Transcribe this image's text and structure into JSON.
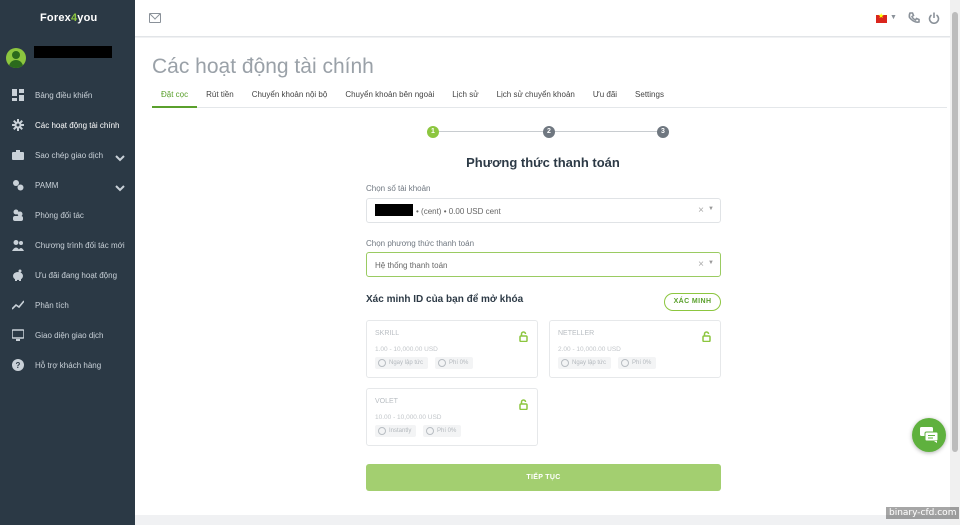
{
  "brand": {
    "logo_pre": "Forex",
    "logo_four": "4",
    "logo_post": "you"
  },
  "sidebar": {
    "items": [
      {
        "label": "Bảng điều khiển",
        "icon": "dashboard-icon"
      },
      {
        "label": "Các hoạt động tài chính",
        "icon": "gear-icon",
        "active": true
      },
      {
        "label": "Sao chép giao dịch",
        "icon": "briefcase-icon",
        "expandable": true
      },
      {
        "label": "PAMM",
        "icon": "pamm-icon",
        "expandable": true
      },
      {
        "label": "Phòng đối tác",
        "icon": "partner-icon"
      },
      {
        "label": "Chương trình đối tác mới",
        "icon": "users-icon"
      },
      {
        "label": "Ưu đãi đang hoạt động",
        "icon": "piggy-icon"
      },
      {
        "label": "Phân tích",
        "icon": "chart-line-icon"
      },
      {
        "label": "Giao diện giao dịch",
        "icon": "terminal-icon"
      },
      {
        "label": "Hỗ trợ khách hàng",
        "icon": "help-icon"
      }
    ]
  },
  "header": {
    "page_title": "Các hoạt động tài chính",
    "tabs": [
      {
        "label": "Đặt cọc",
        "active": true
      },
      {
        "label": "Rút tiền"
      },
      {
        "label": "Chuyển khoản nội bộ"
      },
      {
        "label": "Chuyển khoản bên ngoài"
      },
      {
        "label": "Lịch sử"
      },
      {
        "label": "Lịch sử chuyển khoản"
      },
      {
        "label": "Ưu đãi"
      },
      {
        "label": "Settings"
      }
    ]
  },
  "stepper": {
    "steps": [
      "1",
      "2",
      "3"
    ],
    "current": 1
  },
  "form": {
    "title": "Phương thức thanh toán",
    "account_label": "Chọn số tài khoản",
    "account_value": "• (cent) • 0.00 USD cent",
    "method_label": "Chọn phương thức thanh toán",
    "method_value": "Hệ thống thanh toán",
    "clear_glyph": "×",
    "arrow_glyph": "▼"
  },
  "verify": {
    "title": "Xác minh ID của bạn để mở khóa",
    "button": "XÁC MINH"
  },
  "methods": [
    {
      "name": "SKRILL",
      "range": "1.00 - 10,000.00 USD",
      "speed": "Ngay lập tức",
      "fee": "Phí 0%"
    },
    {
      "name": "NETELLER",
      "range": "2.00 - 10,000.00 USD",
      "speed": "Ngay lập tức",
      "fee": "Phí 0%"
    },
    {
      "name": "VOLET",
      "range": "10.00 - 10,000.00 USD",
      "speed": "Instantly",
      "fee": "Phí 0%"
    }
  ],
  "continue_button": "TIẾP TỤC",
  "watermark": "binary-cfd.com",
  "colors": {
    "accent": "#8cc63f",
    "sidebar": "#2b3945",
    "tab_active": "#5aa02c"
  }
}
